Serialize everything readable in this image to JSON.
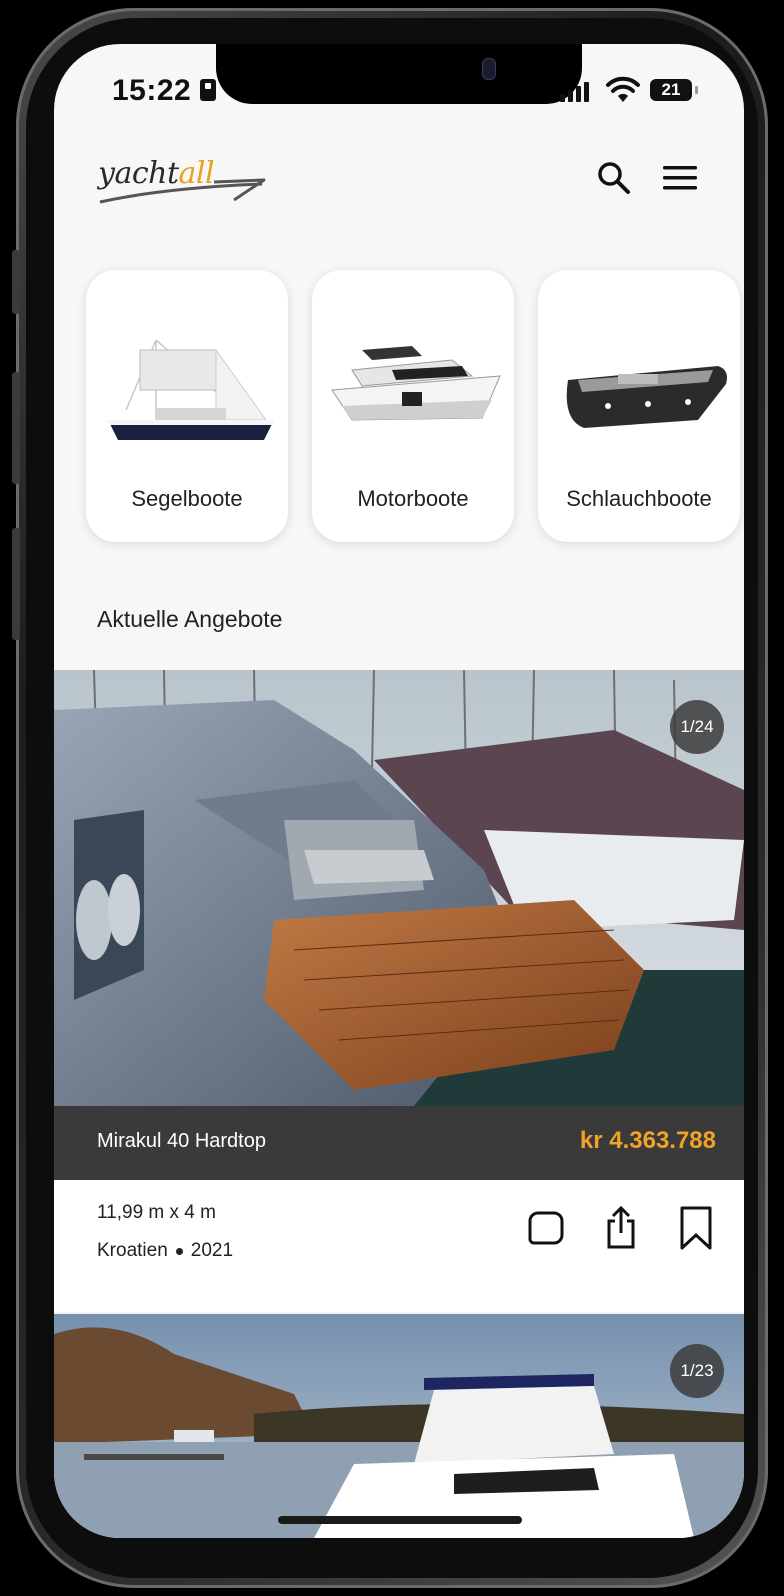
{
  "status_bar": {
    "time": "15:22",
    "battery": "21"
  },
  "header": {
    "logo_prefix": "yacht",
    "logo_accent": "all",
    "brand_color": "#e7a224",
    "search_icon": "search-icon",
    "menu_icon": "hamburger-menu-icon"
  },
  "categories": [
    {
      "label": "Segelboote",
      "icon": "sailboat-image"
    },
    {
      "label": "Motorboote",
      "icon": "motorboat-image"
    },
    {
      "label": "Schlauchboote",
      "icon": "inflatable-boat-image"
    }
  ],
  "section_title": "Aktuelle Angebote",
  "listings": [
    {
      "counter": "1/24",
      "name": "Mirakul 40 Hardtop",
      "price": "kr 4.363.788",
      "dimensions": "11,99 m x 4 m",
      "location": "Kroatien",
      "year": "2021",
      "actions": [
        "chat-icon",
        "share-icon",
        "bookmark-icon"
      ]
    },
    {
      "counter": "1/23"
    }
  ],
  "colors": {
    "price": "#f0a324",
    "title_bar": "#3a3a3a",
    "background": "#f7f7f7"
  }
}
